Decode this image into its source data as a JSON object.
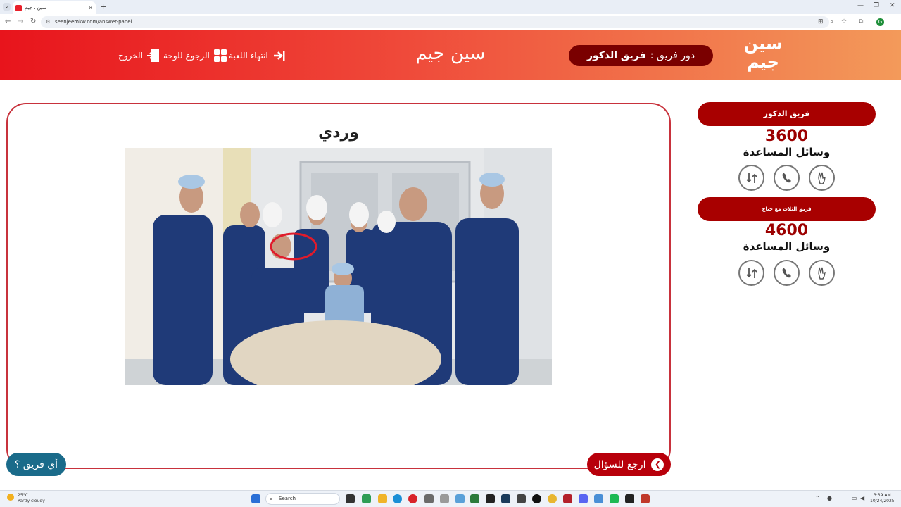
{
  "browser": {
    "tab_title": "سين ، جيم",
    "url": "seenjeemkw.com/answer-panel",
    "new_tab": "+",
    "profile_initial": "G"
  },
  "header": {
    "logo_text_top": "سين",
    "logo_text_bottom": "جيم",
    "turn_label": "دور فريق :",
    "turn_team": "فريق الذكور",
    "site_title": "سين جيم",
    "nav": {
      "end_game": "انتهاء اللعبة",
      "back_to_board": "الرجوع للوحة",
      "exit": "الخروج"
    }
  },
  "main": {
    "answer_text": "وردي",
    "back_to_question": "ارجع للسؤال",
    "which_team": "أي فريق ؟"
  },
  "teams": [
    {
      "name": "فريق الذكور",
      "score": "3600",
      "helpers_label": "وسائل المساعدة"
    },
    {
      "name": "فريق الثلاث مع خباج",
      "score": "4600",
      "helpers_label": "وسائل المساعدة"
    }
  ],
  "taskbar": {
    "temperature": "25°C",
    "weather": "Partly cloudy",
    "search_placeholder": "Search",
    "time": "3:39 AM",
    "date": "10/24/2025"
  },
  "colors": {
    "brand_red": "#e8141c",
    "dark_red": "#a80000",
    "teal": "#1a6b8a"
  }
}
